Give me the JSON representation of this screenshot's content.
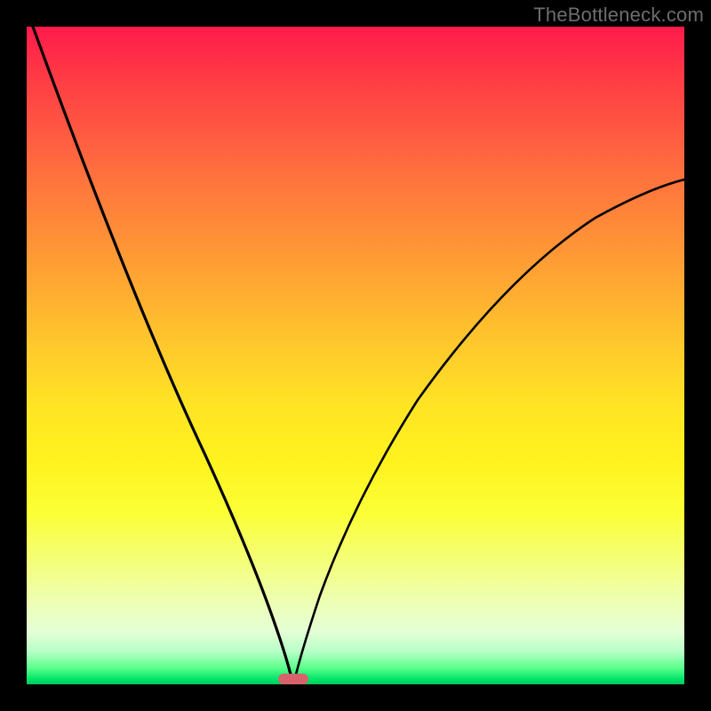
{
  "watermark": {
    "text": "TheBottleneck.com"
  },
  "colors": {
    "curve_stroke": "#000000",
    "marker_fill": "#d7626b"
  },
  "chart_data": {
    "type": "line",
    "title": "",
    "xlabel": "",
    "ylabel": "",
    "xlim": [
      0,
      100
    ],
    "ylim": [
      0,
      100
    ],
    "grid": false,
    "legend": false,
    "note": "Two-branch bottleneck curve meeting at minimum; values estimated from pixels (no axis labels).",
    "minimum_x": 40,
    "minimum_y": 0,
    "marker": {
      "x": 40,
      "y": 0,
      "w": 4.6,
      "h": 1.6
    },
    "series": [
      {
        "name": "left-branch",
        "x": [
          1,
          5,
          10,
          15,
          20,
          25,
          30,
          33,
          36,
          38,
          39,
          40
        ],
        "values": [
          100,
          90,
          79,
          67,
          55,
          43,
          30,
          21,
          12,
          6,
          2,
          0
        ]
      },
      {
        "name": "right-branch",
        "x": [
          40,
          41,
          43,
          46,
          50,
          55,
          60,
          70,
          80,
          90,
          100
        ],
        "values": [
          0,
          3,
          8,
          14,
          22,
          31,
          38,
          51,
          61,
          69,
          76
        ]
      }
    ]
  }
}
